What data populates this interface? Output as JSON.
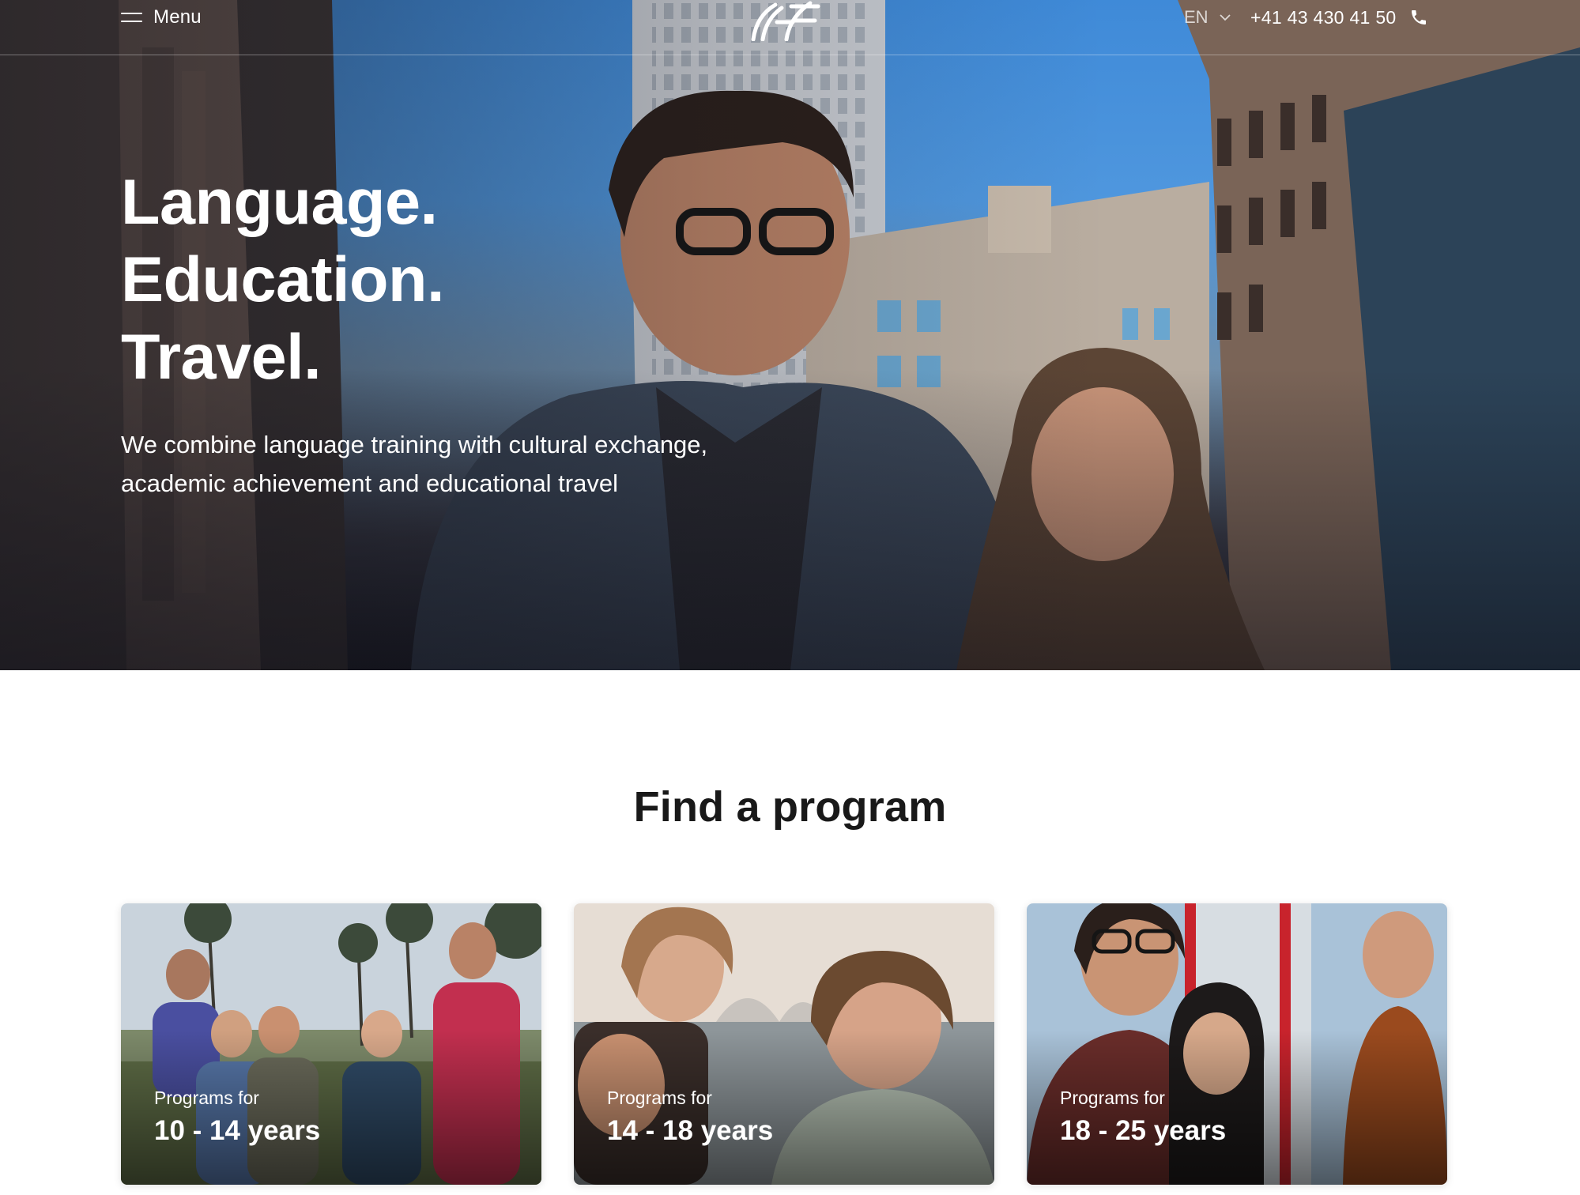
{
  "header": {
    "menu_label": "Menu",
    "language": "EN",
    "phone": "+41 43 430 41 50",
    "logo_name": "ef-logo"
  },
  "hero": {
    "headline": [
      "Language.",
      "Education.",
      "Travel."
    ],
    "lead": "We combine language training with cultural exchange, academic achievement and educational travel"
  },
  "programs": {
    "title": "Find a program",
    "cards": [
      {
        "kicker": "Programs for",
        "range": "10 - 14 years"
      },
      {
        "kicker": "Programs for",
        "range": "14 - 18 years"
      },
      {
        "kicker": "Programs for",
        "range": "18 - 25 years"
      }
    ]
  },
  "colors": {
    "sky": "#4a92dc",
    "text_dark": "#191919",
    "white": "#ffffff"
  }
}
